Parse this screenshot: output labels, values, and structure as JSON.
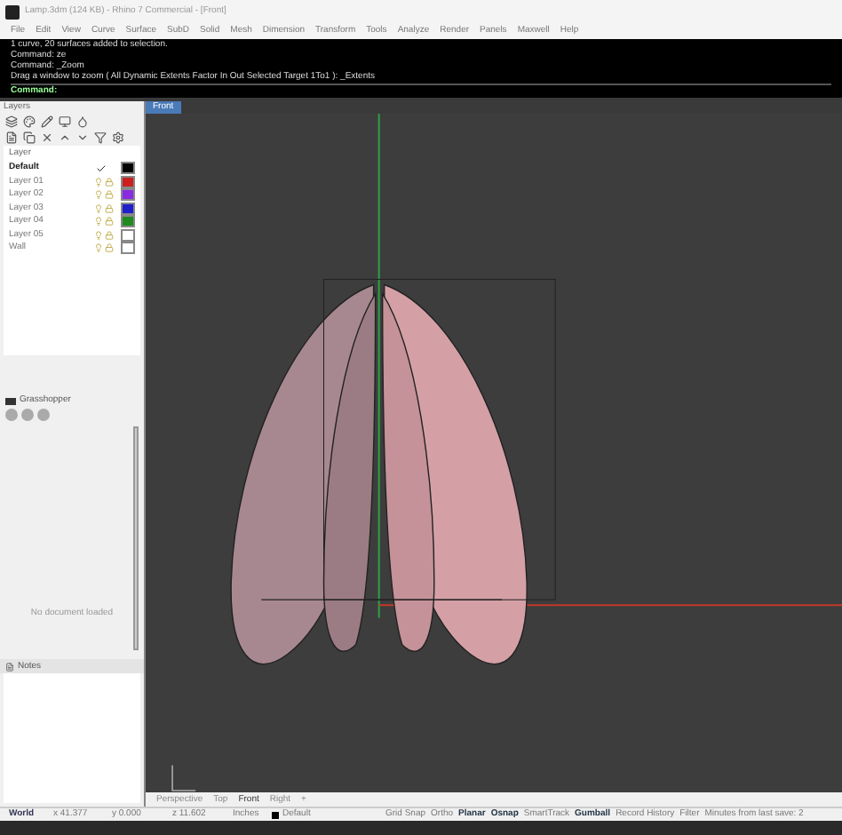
{
  "window": {
    "title": "Lamp.3dm (124 KB) - Rhino 7 Commercial - [Front]"
  },
  "menu": [
    "File",
    "Edit",
    "View",
    "Curve",
    "Surface",
    "SubD",
    "Solid",
    "Mesh",
    "Dimension",
    "Transform",
    "Tools",
    "Analyze",
    "Render",
    "Panels",
    "Maxwell",
    "Help"
  ],
  "command_history": [
    "1 curve, 20 surfaces added to selection.",
    "Command: ze",
    "Command: _Zoom",
    "Drag a window to zoom ( All  Dynamic  Extents  Factor  In  Out  Selected  Target  1To1 ): _Extents"
  ],
  "command_prompt": "Command:",
  "layers_panel": {
    "title": "Layers",
    "column": "Layer",
    "rows": [
      {
        "name": "Default",
        "current": true,
        "color": "#000000"
      },
      {
        "name": "Layer 01",
        "current": false,
        "color": "#cc1f1f"
      },
      {
        "name": "Layer 02",
        "current": false,
        "color": "#8a2be2"
      },
      {
        "name": "Layer 03",
        "current": false,
        "color": "#1f1fcc"
      },
      {
        "name": "Layer 04",
        "current": false,
        "color": "#1f8a1f"
      },
      {
        "name": "Layer 05",
        "current": false,
        "color": "#ffffff"
      },
      {
        "name": "Wall",
        "current": false,
        "color": "#ffffff"
      }
    ]
  },
  "grasshopper_panel": {
    "title": "Grasshopper",
    "message": "No document loaded"
  },
  "notes_panel": {
    "title": "Notes"
  },
  "viewport": {
    "tab": "Front"
  },
  "viewport_tabs": [
    {
      "label": "Perspective",
      "selected": false
    },
    {
      "label": "Top",
      "selected": false
    },
    {
      "label": "Front",
      "selected": true
    },
    {
      "label": "Right",
      "selected": false
    },
    {
      "label": "+",
      "selected": false
    }
  ],
  "status_bar": {
    "cplane": "World",
    "x": "x 41.377",
    "y": "y 0.000",
    "z": "z 11.602",
    "units": "Inches",
    "layer": "Default",
    "toggles": [
      {
        "label": "Grid Snap",
        "on": false
      },
      {
        "label": "Ortho",
        "on": false
      },
      {
        "label": "Planar",
        "on": true
      },
      {
        "label": "Osnap",
        "on": true
      },
      {
        "label": "SmartTrack",
        "on": false
      },
      {
        "label": "Gumball",
        "on": true
      },
      {
        "label": "Record History",
        "on": false
      },
      {
        "label": "Filter",
        "on": false
      }
    ],
    "save_info": "Minutes from last save: 2"
  }
}
